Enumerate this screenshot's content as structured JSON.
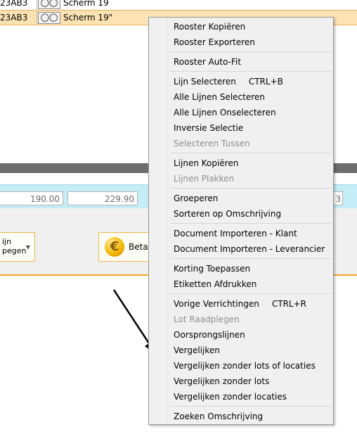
{
  "grid": {
    "rows": [
      {
        "code": "23AB3",
        "icon": "glasses-icon",
        "desc": "Scherm 19",
        "highlight": false
      },
      {
        "code": "23AB3",
        "icon": "glasses-icon",
        "desc": "Scherm 19\"",
        "highlight": true
      }
    ]
  },
  "totals": {
    "value1": "190.00",
    "value2": "229.90",
    "value3": "3"
  },
  "toolbar": {
    "button1_line1": "ijn",
    "button1_line2": "pegen",
    "button2_label": "Betali",
    "button2_icon": "euro-icon"
  },
  "context_menu": {
    "groups": [
      [
        {
          "label": "Rooster Kopiëren",
          "disabled": false
        },
        {
          "label": "Rooster Exporteren",
          "disabled": false
        }
      ],
      [
        {
          "label": "Rooster Auto-Fit",
          "disabled": false
        }
      ],
      [
        {
          "label": "Lijn Selecteren",
          "shortcut": "CTRL+B",
          "disabled": false
        },
        {
          "label": "Alle Lijnen Selecteren",
          "disabled": false
        },
        {
          "label": "Alle Lijnen Onselecteren",
          "disabled": false
        },
        {
          "label": "Inversie Selectie",
          "disabled": false
        },
        {
          "label": "Selecteren Tussen",
          "disabled": true
        }
      ],
      [
        {
          "label": "Lijnen Kopiëren",
          "disabled": false
        },
        {
          "label": "Lijnen Plakken",
          "disabled": true
        }
      ],
      [
        {
          "label": "Groeperen",
          "disabled": false
        },
        {
          "label": "Sorteren op Omschrijving",
          "disabled": false
        }
      ],
      [
        {
          "label": "Document Importeren - Klant",
          "disabled": false
        },
        {
          "label": "Document Importeren - Leverancier",
          "disabled": false
        }
      ],
      [
        {
          "label": "Korting Toepassen",
          "disabled": false
        },
        {
          "label": "Etiketten Afdrukken",
          "disabled": false
        }
      ],
      [
        {
          "label": "Vorige Verrichtingen",
          "shortcut": "CTRL+R",
          "disabled": false
        },
        {
          "label": "Lot Raadplegen",
          "disabled": true
        },
        {
          "label": "Oorsprongslijnen",
          "disabled": false
        },
        {
          "label": "Vergelijken",
          "disabled": false
        },
        {
          "label": "Vergelijken zonder lots of locaties",
          "disabled": false
        },
        {
          "label": "Vergelijken zonder lots",
          "disabled": false
        },
        {
          "label": "Vergelijken zonder locaties",
          "disabled": false
        }
      ],
      [
        {
          "label": "Zoeken Omschrijving",
          "disabled": false
        }
      ]
    ]
  },
  "colors": {
    "highlight_row": "#fde3b3",
    "totals_bg": "#c4edf8",
    "accent_orange": "#f5a623",
    "menu_bg": "#f0f0f0",
    "disabled_text": "#8e8e8e"
  }
}
